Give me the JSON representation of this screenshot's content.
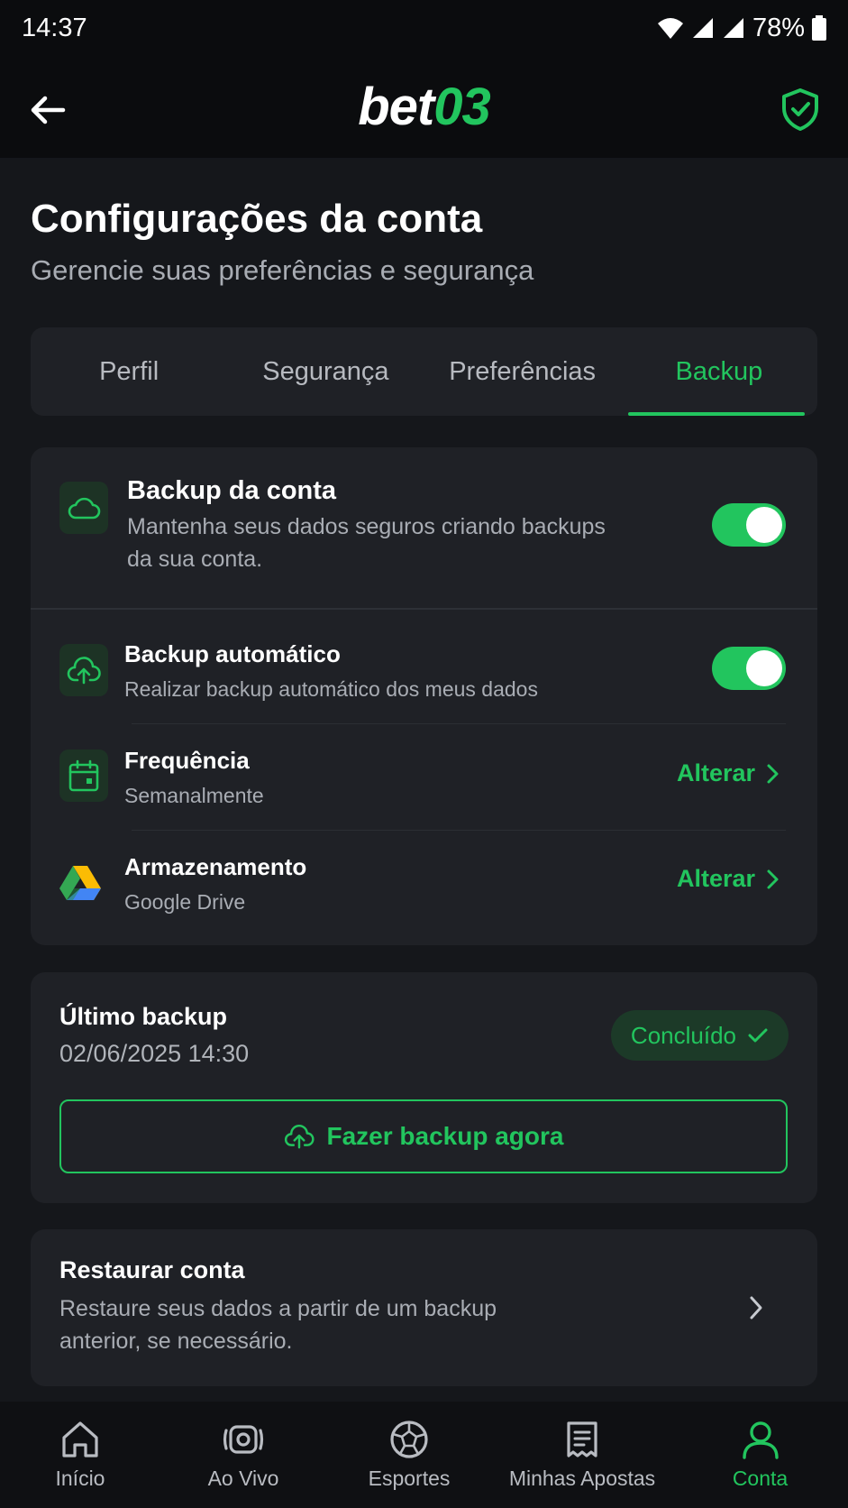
{
  "status_bar": {
    "time": "14:37",
    "battery": "78%"
  },
  "app": {
    "logo_white": "bet",
    "logo_green": "03"
  },
  "page": {
    "title": "Configurações da conta",
    "subtitle": "Gerencie suas preferências e segurança"
  },
  "tabs": [
    {
      "label": "Perfil"
    },
    {
      "label": "Segurança"
    },
    {
      "label": "Preferências"
    },
    {
      "label": "Backup",
      "active": true
    }
  ],
  "backup_account": {
    "title": "Backup da conta",
    "desc_line1": "Mantenha seus dados seguros criando backups",
    "desc_line2": "da sua conta.",
    "enabled": true
  },
  "auto_backup": {
    "title": "Backup automático",
    "desc": "Realizar backup automático dos meus dados",
    "enabled": true
  },
  "frequency": {
    "title": "Frequência",
    "value": "Semanalmente",
    "action": "Alterar"
  },
  "storage": {
    "title": "Armazenamento",
    "value": "Google Drive",
    "action": "Alterar"
  },
  "last_backup": {
    "title": "Último backup",
    "datetime": "02/06/2025 14:30",
    "status": "Concluído",
    "button": "Fazer backup agora"
  },
  "restore": {
    "title": "Restaurar conta",
    "desc_line1": "Restaure seus dados a partir de um backup",
    "desc_line2": "anterior, se necessário."
  },
  "bottom_nav": [
    {
      "label": "Início",
      "icon": "home-icon"
    },
    {
      "label": "Ao Vivo",
      "icon": "live-icon"
    },
    {
      "label": "Esportes",
      "icon": "sports-ball-icon"
    },
    {
      "label": "Minhas Apostas",
      "icon": "bets-ticket-icon"
    },
    {
      "label": "Conta",
      "icon": "user-icon",
      "active": true
    }
  ],
  "colors": {
    "accent": "#22c55e",
    "background": "#15171b",
    "card": "#1f2126"
  }
}
